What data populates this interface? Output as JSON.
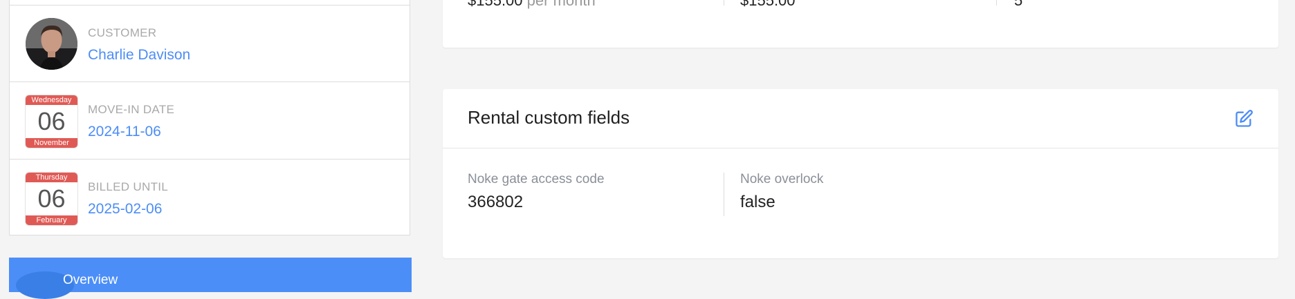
{
  "customer": {
    "label": "CUSTOMER",
    "name": "Charlie Davison"
  },
  "move_in": {
    "label": "MOVE-IN DATE",
    "value": "2024-11-06",
    "calendar": {
      "weekday": "Wednesday",
      "day": "06",
      "month": "November"
    }
  },
  "billed_until": {
    "label": "BILLED UNTIL",
    "value": "2025-02-06",
    "calendar": {
      "weekday": "Thursday",
      "day": "06",
      "month": "February"
    }
  },
  "nav": {
    "active_label": "Overview"
  },
  "rental_summary": {
    "rate": "$155.00",
    "rate_suffix": "per month",
    "amount": "$155.00",
    "count": "5"
  },
  "custom_fields_card": {
    "title": "Rental custom fields",
    "fields": [
      {
        "label": "Noke gate access code",
        "value": "366802"
      },
      {
        "label": "Noke overlock",
        "value": "false"
      }
    ]
  },
  "colors": {
    "accent_blue": "#4c8df6",
    "nav_blue": "#4b8ef7",
    "calendar_red": "#e05a55"
  },
  "icons": {
    "edit": "edit-icon"
  }
}
